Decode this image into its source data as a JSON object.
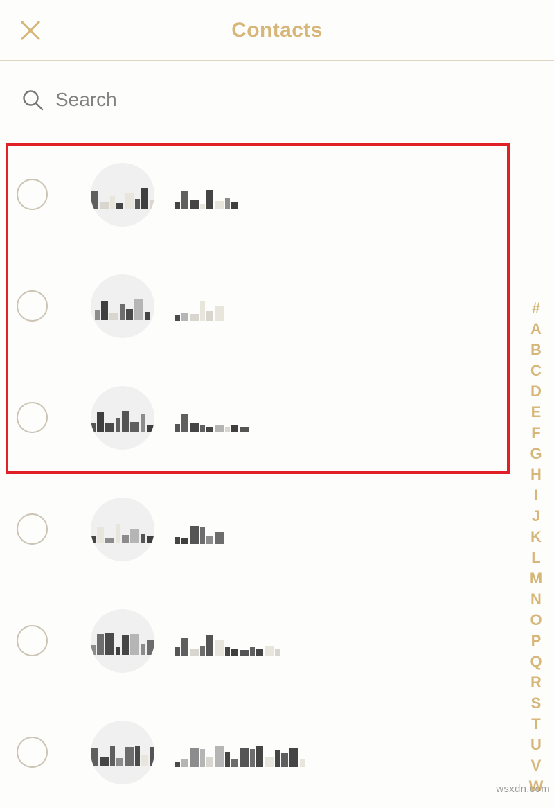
{
  "header": {
    "title": "Contacts",
    "close_icon": "close-icon",
    "title_color": "#d6b679",
    "divider_color": "#ded6c2"
  },
  "search": {
    "icon": "search-icon",
    "placeholder": "Search",
    "value": ""
  },
  "contacts": {
    "rows": [
      {
        "selected": false,
        "avatar_initials_redacted": true,
        "avatar_blocks": [
          12,
          26,
          10,
          18,
          8,
          22,
          14,
          30,
          12
        ],
        "name_redacted": true,
        "name_blocks": [
          10,
          26,
          14,
          8,
          28,
          12,
          16,
          10
        ]
      },
      {
        "selected": false,
        "avatar_initials_redacted": true,
        "avatar_blocks": [
          14,
          28,
          10,
          24,
          16,
          30,
          12
        ],
        "name_redacted": true,
        "name_blocks": [
          8,
          12,
          10,
          28,
          14,
          22
        ]
      },
      {
        "selected": false,
        "avatar_initials_redacted": true,
        "avatar_blocks": [
          12,
          28,
          12,
          20,
          30,
          14,
          26,
          10
        ],
        "name_redacted": true,
        "name_blocks": [
          12,
          26,
          14,
          10,
          8,
          10,
          8,
          10,
          8
        ]
      },
      {
        "selected": false,
        "avatar_initials_redacted": true,
        "avatar_blocks": [
          10,
          24,
          8,
          28,
          12,
          20,
          14,
          10
        ],
        "name_redacted": true,
        "name_blocks": [
          10,
          8,
          26,
          24,
          12,
          18
        ]
      },
      {
        "selected": false,
        "avatar_initials_redacted": true,
        "avatar_blocks": [
          14,
          30,
          32,
          12,
          28,
          30,
          16,
          22
        ],
        "name_redacted": true,
        "name_blocks": [
          12,
          26,
          10,
          14,
          30,
          22,
          12,
          10,
          8,
          12,
          10,
          14,
          10
        ]
      },
      {
        "selected": false,
        "avatar_initials_redacted": true,
        "avatar_blocks": [
          10,
          26,
          14,
          30,
          12,
          28,
          30,
          16,
          28
        ],
        "name_redacted": true,
        "name_blocks": [
          8,
          12,
          28,
          26,
          14,
          30,
          22,
          12,
          28,
          26,
          30,
          14,
          24,
          20,
          28,
          12
        ]
      }
    ]
  },
  "highlight": {
    "color": "#e02027",
    "label": "highlight-box"
  },
  "alphabet_index": {
    "letters": [
      "#",
      "A",
      "B",
      "C",
      "D",
      "E",
      "F",
      "G",
      "H",
      "I",
      "J",
      "K",
      "L",
      "M",
      "N",
      "O",
      "P",
      "Q",
      "R",
      "S",
      "T",
      "U",
      "V",
      "W"
    ],
    "color": "#d6b679"
  },
  "watermark": {
    "text": "wsxdn.com"
  }
}
